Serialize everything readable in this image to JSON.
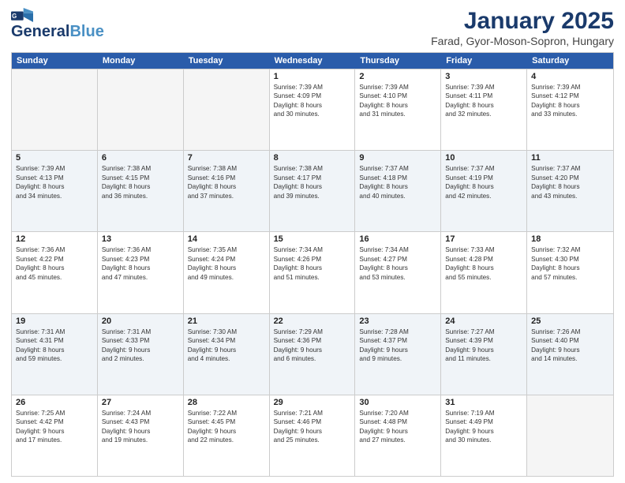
{
  "header": {
    "logo_line1": "General",
    "logo_line2": "Blue",
    "title": "January 2025",
    "subtitle": "Farad, Gyor-Moson-Sopron, Hungary"
  },
  "weekdays": [
    "Sunday",
    "Monday",
    "Tuesday",
    "Wednesday",
    "Thursday",
    "Friday",
    "Saturday"
  ],
  "weeks": [
    [
      {
        "day": "",
        "info": "",
        "empty": true
      },
      {
        "day": "",
        "info": "",
        "empty": true
      },
      {
        "day": "",
        "info": "",
        "empty": true
      },
      {
        "day": "1",
        "info": "Sunrise: 7:39 AM\nSunset: 4:09 PM\nDaylight: 8 hours\nand 30 minutes.",
        "empty": false
      },
      {
        "day": "2",
        "info": "Sunrise: 7:39 AM\nSunset: 4:10 PM\nDaylight: 8 hours\nand 31 minutes.",
        "empty": false
      },
      {
        "day": "3",
        "info": "Sunrise: 7:39 AM\nSunset: 4:11 PM\nDaylight: 8 hours\nand 32 minutes.",
        "empty": false
      },
      {
        "day": "4",
        "info": "Sunrise: 7:39 AM\nSunset: 4:12 PM\nDaylight: 8 hours\nand 33 minutes.",
        "empty": false
      }
    ],
    [
      {
        "day": "5",
        "info": "Sunrise: 7:39 AM\nSunset: 4:13 PM\nDaylight: 8 hours\nand 34 minutes.",
        "empty": false
      },
      {
        "day": "6",
        "info": "Sunrise: 7:38 AM\nSunset: 4:15 PM\nDaylight: 8 hours\nand 36 minutes.",
        "empty": false
      },
      {
        "day": "7",
        "info": "Sunrise: 7:38 AM\nSunset: 4:16 PM\nDaylight: 8 hours\nand 37 minutes.",
        "empty": false
      },
      {
        "day": "8",
        "info": "Sunrise: 7:38 AM\nSunset: 4:17 PM\nDaylight: 8 hours\nand 39 minutes.",
        "empty": false
      },
      {
        "day": "9",
        "info": "Sunrise: 7:37 AM\nSunset: 4:18 PM\nDaylight: 8 hours\nand 40 minutes.",
        "empty": false
      },
      {
        "day": "10",
        "info": "Sunrise: 7:37 AM\nSunset: 4:19 PM\nDaylight: 8 hours\nand 42 minutes.",
        "empty": false
      },
      {
        "day": "11",
        "info": "Sunrise: 7:37 AM\nSunset: 4:20 PM\nDaylight: 8 hours\nand 43 minutes.",
        "empty": false
      }
    ],
    [
      {
        "day": "12",
        "info": "Sunrise: 7:36 AM\nSunset: 4:22 PM\nDaylight: 8 hours\nand 45 minutes.",
        "empty": false
      },
      {
        "day": "13",
        "info": "Sunrise: 7:36 AM\nSunset: 4:23 PM\nDaylight: 8 hours\nand 47 minutes.",
        "empty": false
      },
      {
        "day": "14",
        "info": "Sunrise: 7:35 AM\nSunset: 4:24 PM\nDaylight: 8 hours\nand 49 minutes.",
        "empty": false
      },
      {
        "day": "15",
        "info": "Sunrise: 7:34 AM\nSunset: 4:26 PM\nDaylight: 8 hours\nand 51 minutes.",
        "empty": false
      },
      {
        "day": "16",
        "info": "Sunrise: 7:34 AM\nSunset: 4:27 PM\nDaylight: 8 hours\nand 53 minutes.",
        "empty": false
      },
      {
        "day": "17",
        "info": "Sunrise: 7:33 AM\nSunset: 4:28 PM\nDaylight: 8 hours\nand 55 minutes.",
        "empty": false
      },
      {
        "day": "18",
        "info": "Sunrise: 7:32 AM\nSunset: 4:30 PM\nDaylight: 8 hours\nand 57 minutes.",
        "empty": false
      }
    ],
    [
      {
        "day": "19",
        "info": "Sunrise: 7:31 AM\nSunset: 4:31 PM\nDaylight: 8 hours\nand 59 minutes.",
        "empty": false
      },
      {
        "day": "20",
        "info": "Sunrise: 7:31 AM\nSunset: 4:33 PM\nDaylight: 9 hours\nand 2 minutes.",
        "empty": false
      },
      {
        "day": "21",
        "info": "Sunrise: 7:30 AM\nSunset: 4:34 PM\nDaylight: 9 hours\nand 4 minutes.",
        "empty": false
      },
      {
        "day": "22",
        "info": "Sunrise: 7:29 AM\nSunset: 4:36 PM\nDaylight: 9 hours\nand 6 minutes.",
        "empty": false
      },
      {
        "day": "23",
        "info": "Sunrise: 7:28 AM\nSunset: 4:37 PM\nDaylight: 9 hours\nand 9 minutes.",
        "empty": false
      },
      {
        "day": "24",
        "info": "Sunrise: 7:27 AM\nSunset: 4:39 PM\nDaylight: 9 hours\nand 11 minutes.",
        "empty": false
      },
      {
        "day": "25",
        "info": "Sunrise: 7:26 AM\nSunset: 4:40 PM\nDaylight: 9 hours\nand 14 minutes.",
        "empty": false
      }
    ],
    [
      {
        "day": "26",
        "info": "Sunrise: 7:25 AM\nSunset: 4:42 PM\nDaylight: 9 hours\nand 17 minutes.",
        "empty": false
      },
      {
        "day": "27",
        "info": "Sunrise: 7:24 AM\nSunset: 4:43 PM\nDaylight: 9 hours\nand 19 minutes.",
        "empty": false
      },
      {
        "day": "28",
        "info": "Sunrise: 7:22 AM\nSunset: 4:45 PM\nDaylight: 9 hours\nand 22 minutes.",
        "empty": false
      },
      {
        "day": "29",
        "info": "Sunrise: 7:21 AM\nSunset: 4:46 PM\nDaylight: 9 hours\nand 25 minutes.",
        "empty": false
      },
      {
        "day": "30",
        "info": "Sunrise: 7:20 AM\nSunset: 4:48 PM\nDaylight: 9 hours\nand 27 minutes.",
        "empty": false
      },
      {
        "day": "31",
        "info": "Sunrise: 7:19 AM\nSunset: 4:49 PM\nDaylight: 9 hours\nand 30 minutes.",
        "empty": false
      },
      {
        "day": "",
        "info": "",
        "empty": true
      }
    ]
  ]
}
